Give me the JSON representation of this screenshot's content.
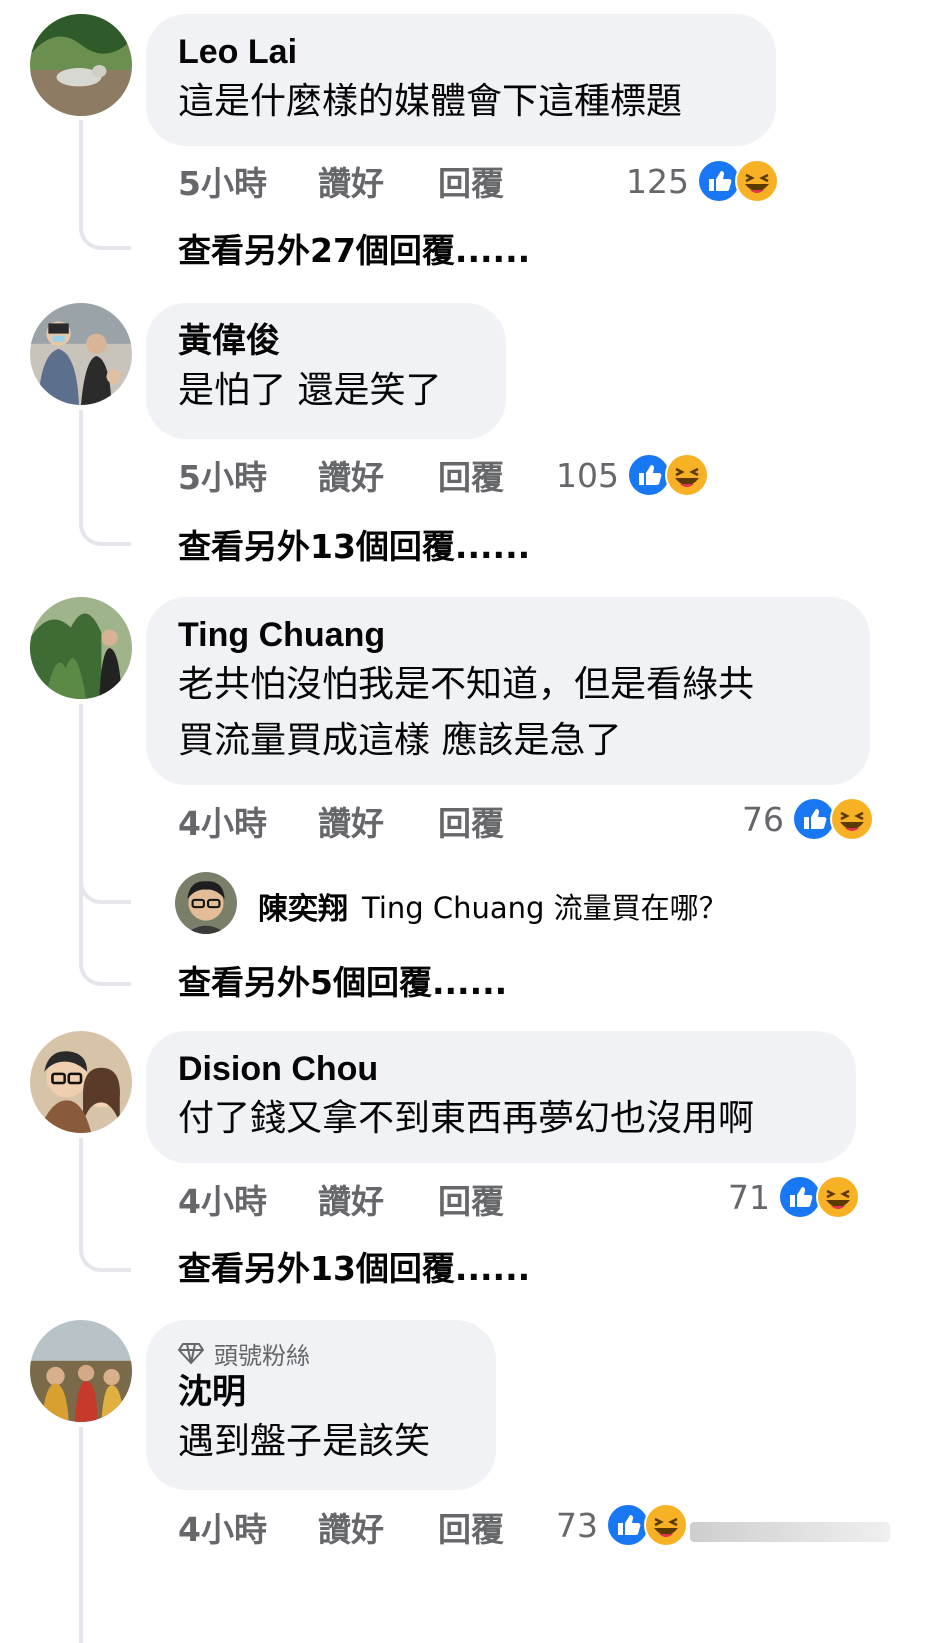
{
  "comments": [
    {
      "author": "Leo Lai",
      "text_lines": [
        "這是什麼樣的媒體會下這種標題"
      ],
      "time": "5小時",
      "like": "讚好",
      "reply": "回覆",
      "reaction_count": "125",
      "more_replies": "查看另外27個回覆......"
    },
    {
      "author": "黃偉俊",
      "text_lines": [
        "是怕了 還是笑了"
      ],
      "time": "5小時",
      "like": "讚好",
      "reply": "回覆",
      "reaction_count": "105",
      "more_replies": "查看另外13個回覆......"
    },
    {
      "author": "Ting Chuang",
      "text_lines": [
        "老共怕沒怕我是不知道，但是看綠共",
        "買流量買成這樣 應該是急了"
      ],
      "time": "4小時",
      "like": "讚好",
      "reply": "回覆",
      "reaction_count": "76",
      "sub_reply": {
        "author": "陳奕翔",
        "text": "Ting Chuang 流量買在哪？"
      },
      "more_replies": "查看另外5個回覆......"
    },
    {
      "author": "Dision Chou",
      "text_lines": [
        "付了錢又拿不到東西再夢幻也沒用啊"
      ],
      "time": "4小時",
      "like": "讚好",
      "reply": "回覆",
      "reaction_count": "71",
      "more_replies": "查看另外13個回覆......"
    },
    {
      "badge": "頭號粉絲",
      "author": "沈明",
      "text_lines": [
        "遇到盤子是該笑"
      ],
      "time": "4小時",
      "like": "讚好",
      "reply": "回覆",
      "reaction_count": "73"
    }
  ],
  "colors": {
    "bubble": "#f0f2f5",
    "meta_text": "#65676b",
    "like_blue": "#1877f2",
    "haha_yellow": "#f7b125",
    "thread_line": "#e4e6eb"
  }
}
